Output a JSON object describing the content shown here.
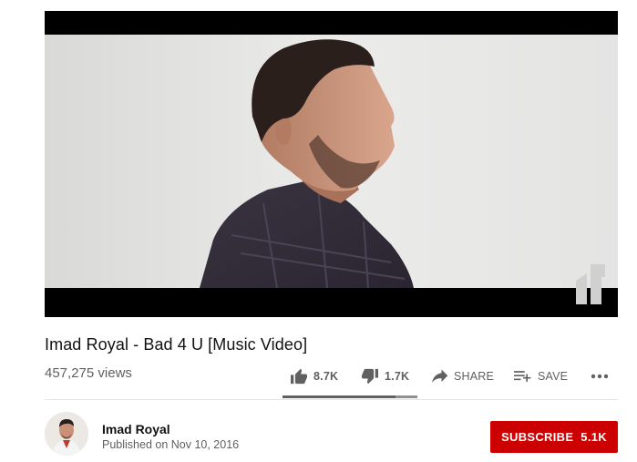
{
  "video": {
    "title": "Imad Royal - Bad 4 U [Music Video]",
    "views": "457,275 views"
  },
  "actions": {
    "like_count": "8.7K",
    "dislike_count": "1.7K",
    "share_label": "SHARE",
    "save_label": "SAVE",
    "like_ratio": 0.84
  },
  "channel": {
    "name": "Imad Royal",
    "published": "Published on Nov 10, 2016"
  },
  "subscribe": {
    "label": "SUBSCRIBE",
    "count": "5.1K",
    "color": "#cc0000"
  },
  "icons": {
    "like": "thumbs-up-icon",
    "dislike": "thumbs-down-icon",
    "share": "share-arrow-icon",
    "save": "playlist-add-icon",
    "more": "more-horizontal-icon"
  }
}
